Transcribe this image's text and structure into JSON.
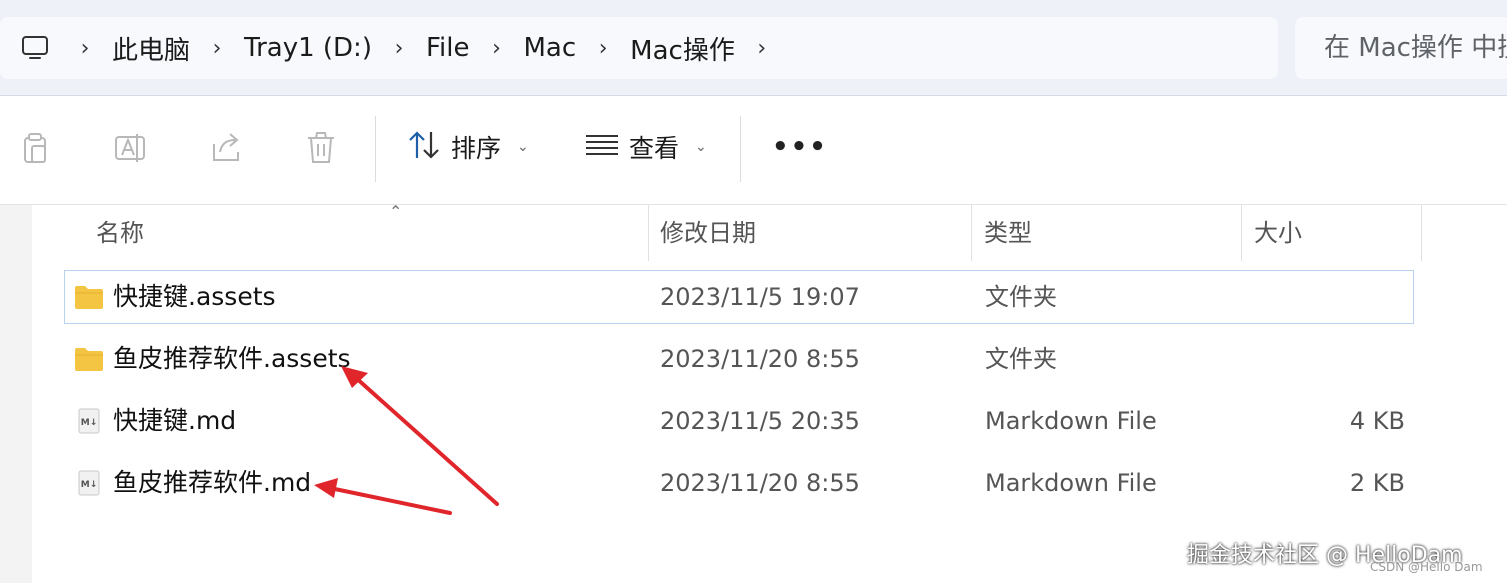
{
  "address_bar": {
    "pc_icon": "computer-icon",
    "crumbs": [
      "此电脑",
      "Tray1 (D:)",
      "File",
      "Mac",
      "Mac操作"
    ],
    "separator_icon": "chevron-right-icon"
  },
  "search": {
    "placeholder": "在 Mac操作 中搜索"
  },
  "toolbar": {
    "sort_label": "排序",
    "view_label": "查看",
    "more_label": "•••",
    "icons": [
      "copy-icon",
      "rename-icon",
      "share-icon",
      "delete-icon",
      "sort-icon",
      "view-icon"
    ]
  },
  "columns": {
    "name": "名称",
    "modified": "修改日期",
    "type": "类型",
    "size": "大小"
  },
  "files": [
    {
      "name": "快捷键.assets",
      "modified": "2023/11/5 19:07",
      "type": "文件夹",
      "size": "",
      "icon": "folder-icon",
      "selected": true
    },
    {
      "name": "鱼皮推荐软件.assets",
      "modified": "2023/11/20 8:55",
      "type": "文件夹",
      "size": "",
      "icon": "folder-icon",
      "selected": false
    },
    {
      "name": "快捷键.md",
      "modified": "2023/11/5 20:35",
      "type": "Markdown File",
      "size": "4 KB",
      "icon": "markdown-file-icon",
      "selected": false
    },
    {
      "name": "鱼皮推荐软件.md",
      "modified": "2023/11/20 8:55",
      "type": "Markdown File",
      "size": "2 KB",
      "icon": "markdown-file-icon",
      "selected": false
    }
  ],
  "watermark": {
    "primary": "掘金技术社区 @ HelloDam",
    "secondary": "CSDN @Hello Dam"
  },
  "colors": {
    "folder": "#f4c543",
    "selection_border": "#b9d3ee",
    "arrow": "#e0262b"
  }
}
